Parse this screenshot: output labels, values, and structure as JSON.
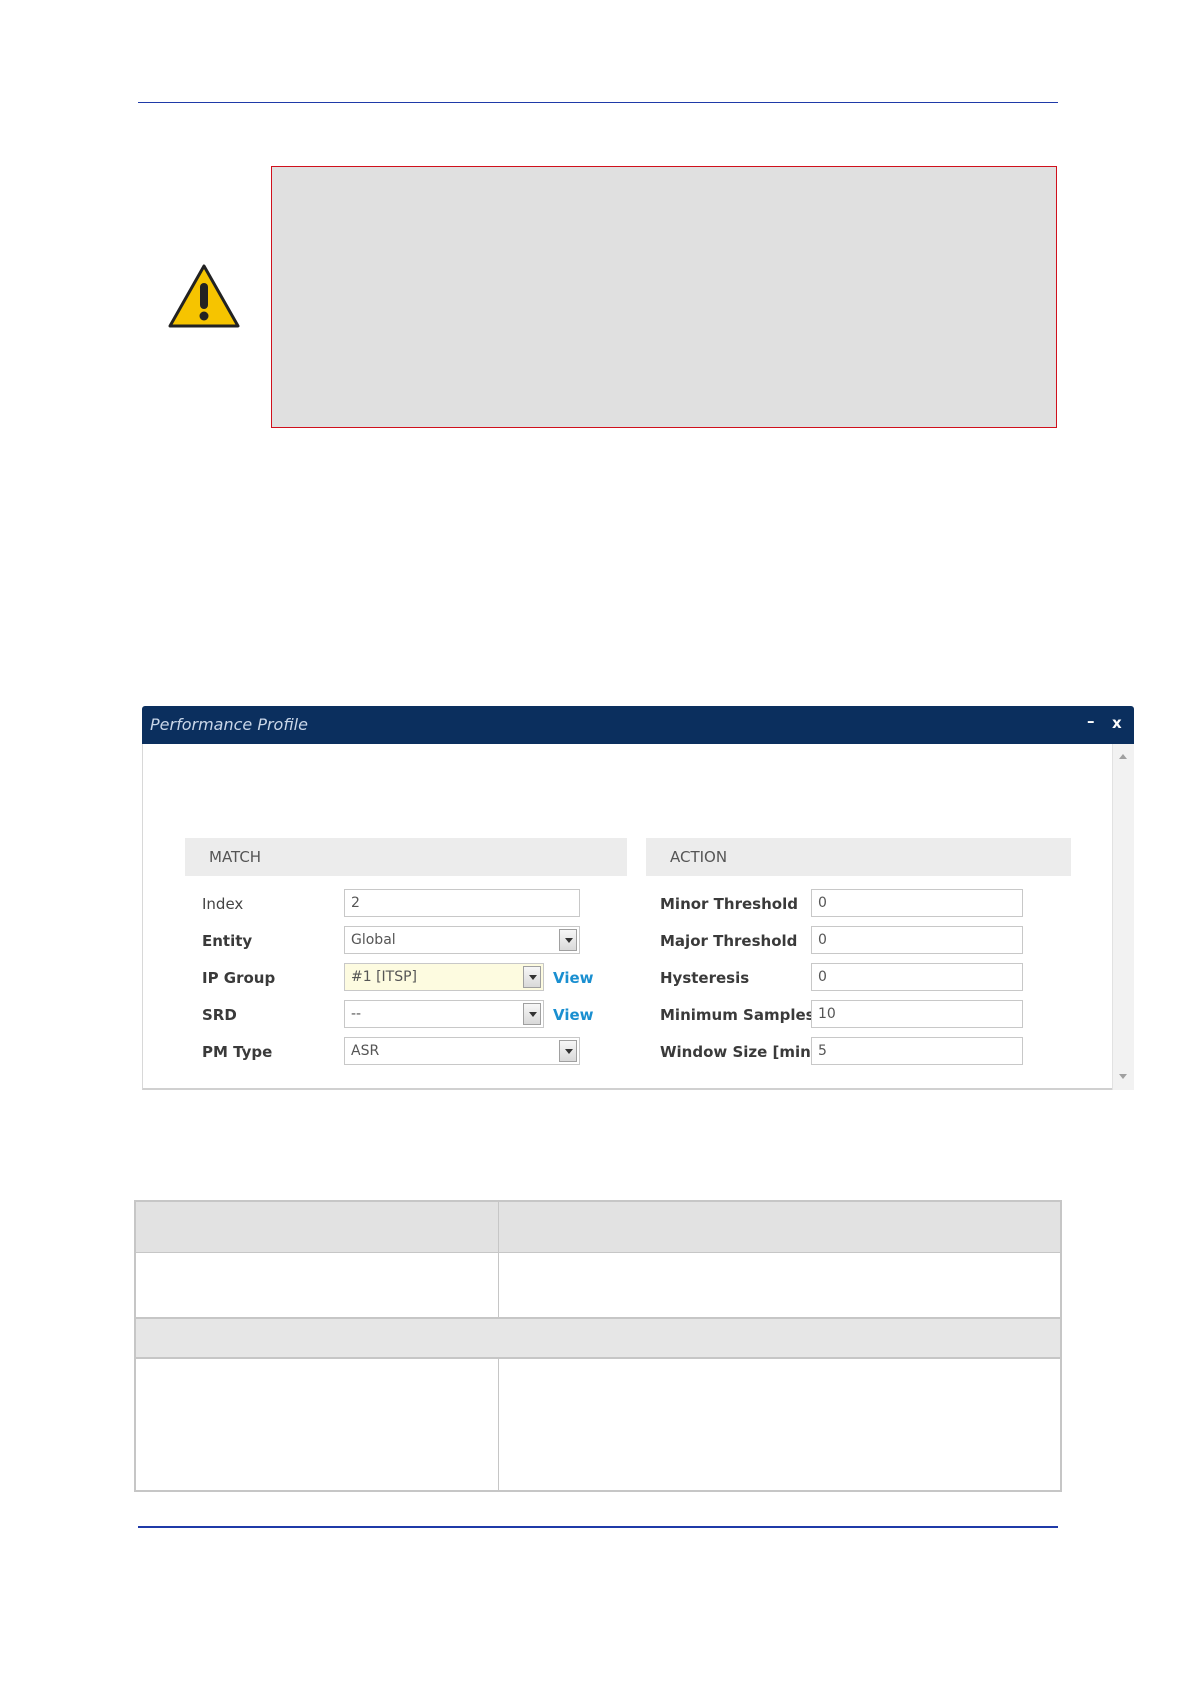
{
  "icons": {
    "warning": "warning-triangle-icon",
    "minimize": "minimize-icon",
    "close": "close-icon"
  },
  "colors": {
    "titlebar": "#0b2f5e",
    "note_border": "#d0101c",
    "link": "#1a8fd0",
    "rule": "#1f3aa8"
  },
  "dialog": {
    "title": "Performance Profile",
    "minimize_label": "–",
    "close_label": "x",
    "match": {
      "heading": "MATCH",
      "fields": [
        {
          "label": "Index",
          "value": "2"
        },
        {
          "label": "Entity",
          "value": "Global"
        },
        {
          "label": "IP Group",
          "value": "#1 [ITSP]",
          "link": "View"
        },
        {
          "label": "SRD",
          "value": "--",
          "link": "View"
        },
        {
          "label": "PM Type",
          "value": "ASR"
        }
      ]
    },
    "action": {
      "heading": "ACTION",
      "fields": [
        {
          "label": "Minor Threshold",
          "value": "0"
        },
        {
          "label": "Major Threshold",
          "value": "0"
        },
        {
          "label": "Hysteresis",
          "value": "0"
        },
        {
          "label": "Minimum Samples",
          "value": "10"
        },
        {
          "label": "Window Size [min]",
          "value": "5"
        }
      ]
    }
  }
}
